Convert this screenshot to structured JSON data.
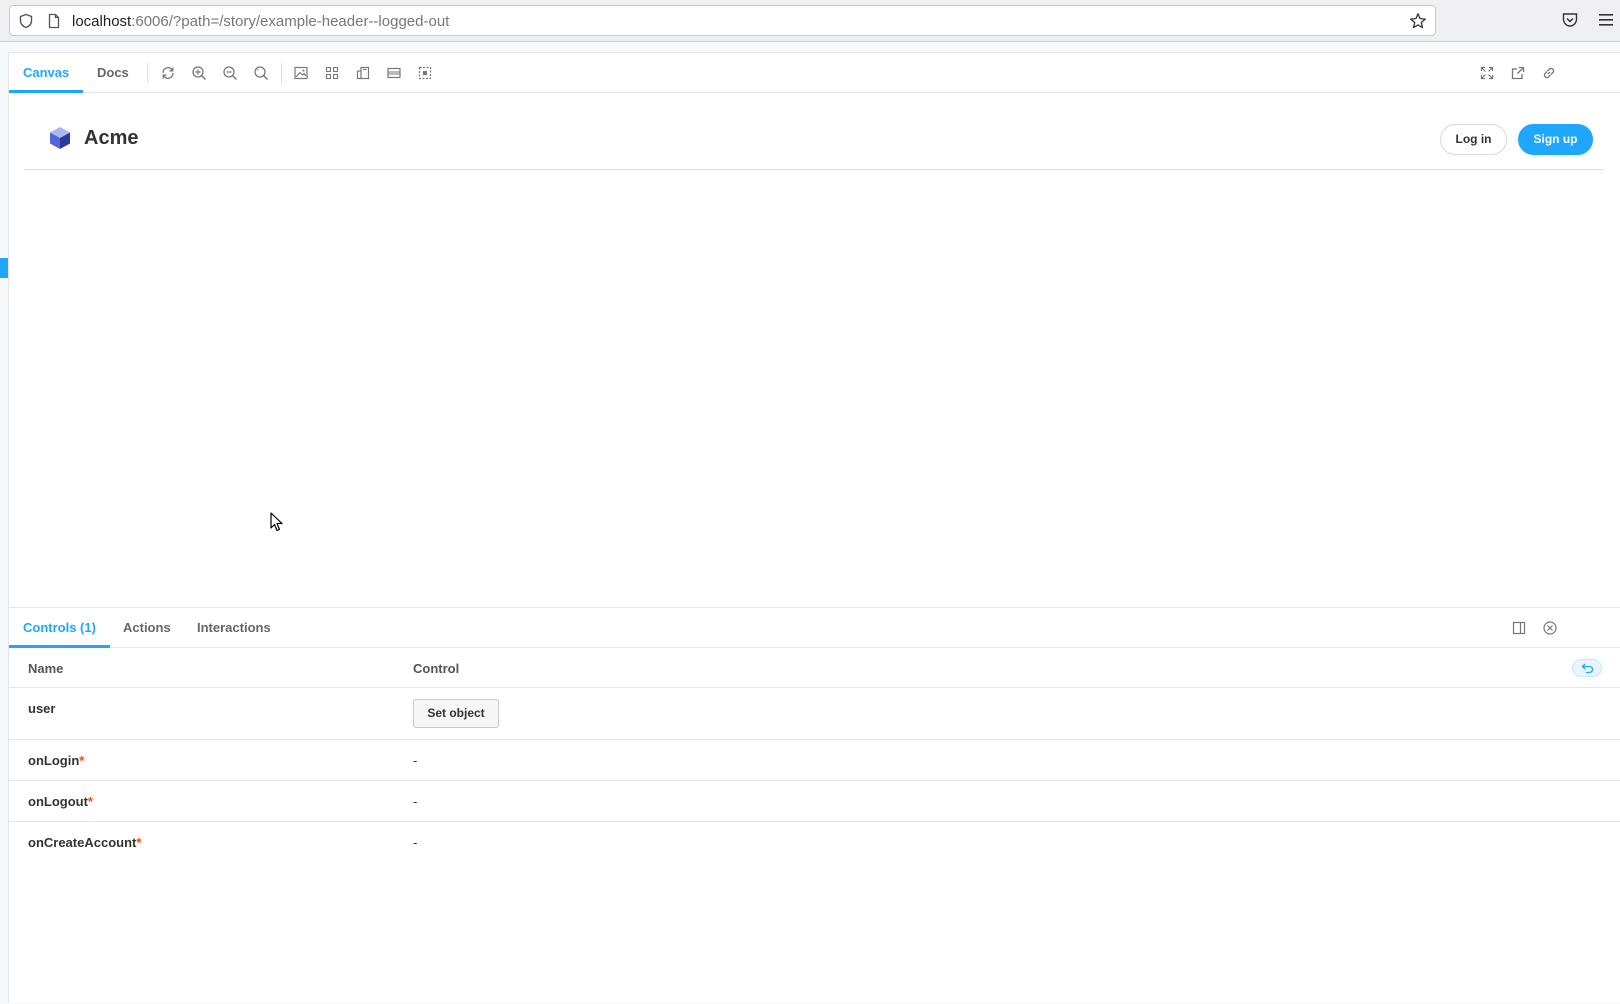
{
  "browser": {
    "url_host": "localhost",
    "url_rest": ":6006/?path=/story/example-header--logged-out"
  },
  "toolbar": {
    "tabs": [
      {
        "label": "Canvas"
      },
      {
        "label": "Docs"
      }
    ]
  },
  "preview": {
    "brand": "Acme",
    "login_label": "Log in",
    "signup_label": "Sign up"
  },
  "addons": {
    "tabs": [
      {
        "label": "Controls (1)"
      },
      {
        "label": "Actions"
      },
      {
        "label": "Interactions"
      }
    ],
    "table": {
      "col_name": "Name",
      "col_control": "Control",
      "rows": [
        {
          "name": "user",
          "required": "",
          "control": "Set object"
        },
        {
          "name": "onLogin",
          "required": "*",
          "control": "-"
        },
        {
          "name": "onLogout",
          "required": "*",
          "control": "-"
        },
        {
          "name": "onCreateAccount",
          "required": "*",
          "control": "-"
        }
      ]
    }
  },
  "colors": {
    "accent": "#1ea7fd",
    "required": "#ff4400"
  }
}
